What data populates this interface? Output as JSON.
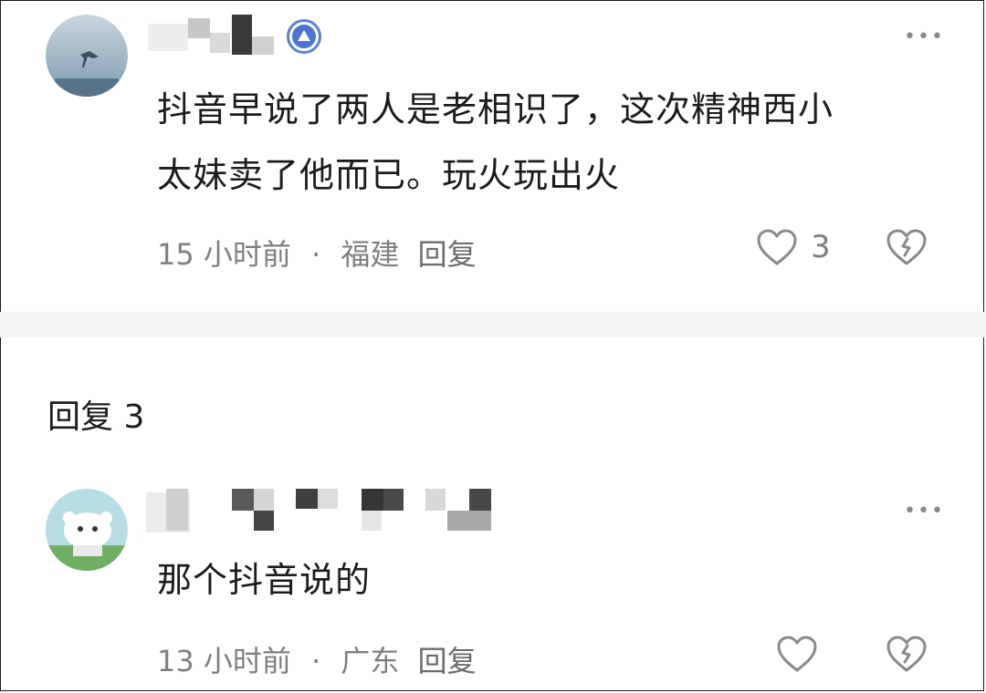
{
  "comments": [
    {
      "text_lines": [
        "抖音早说了两人是老相识了，这次精神西小",
        "太妹卖了他而已。玩火玩出火"
      ],
      "time": "15 小时前",
      "location": "福建",
      "reply_label": "回复",
      "like_count": "3",
      "more_icon": "more-dots-icon",
      "badge_icon": "level-up-badge-icon"
    },
    {
      "text_lines": [
        "那个抖音说的"
      ],
      "time": "13 小时前",
      "location": "广东",
      "reply_label": "回复",
      "like_count": "",
      "more_icon": "more-dots-icon"
    }
  ],
  "replies_header": "回复 3",
  "separator": "·",
  "colors": {
    "text": "#1c1c1c",
    "meta": "#7f7f7f",
    "badge": "#4c74d0"
  }
}
